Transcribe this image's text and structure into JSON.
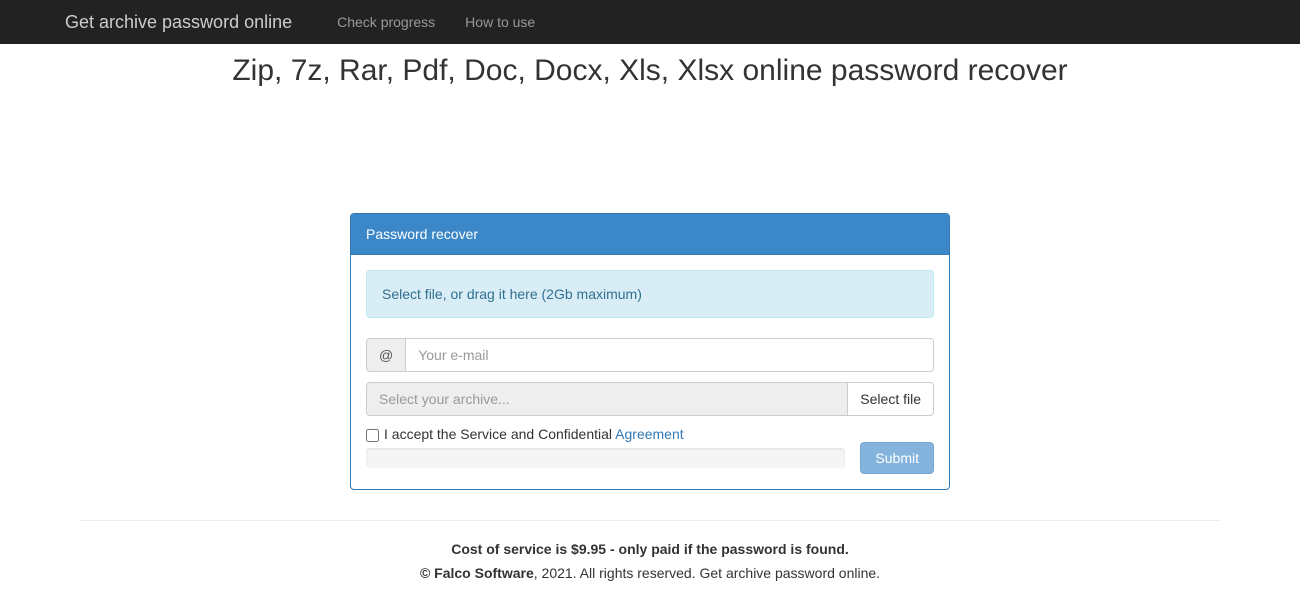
{
  "navbar": {
    "brand": "Get archive password online",
    "links": {
      "check_progress": "Check progress",
      "how_to_use": "How to use"
    }
  },
  "page_title": "Zip, 7z, Rar, Pdf, Doc, Docx, Xls, Xlsx online password recover",
  "panel": {
    "heading": "Password recover",
    "dropzone_text": "Select file, or drag it here (2Gb maximum)",
    "email_addon": "@",
    "email_placeholder": "Your e-mail",
    "archive_placeholder": "Select your archive...",
    "select_file_btn": "Select file",
    "agree_text": "I accept the Service and Confidential ",
    "agree_link": "Agreement",
    "submit_btn": "Submit"
  },
  "footer": {
    "cost_line": "Cost of service is $9.95 - only paid if the password is found.",
    "copyright_strong": "© Falco Software",
    "copyright_rest": ", 2021. All rights reserved. Get archive password online."
  }
}
